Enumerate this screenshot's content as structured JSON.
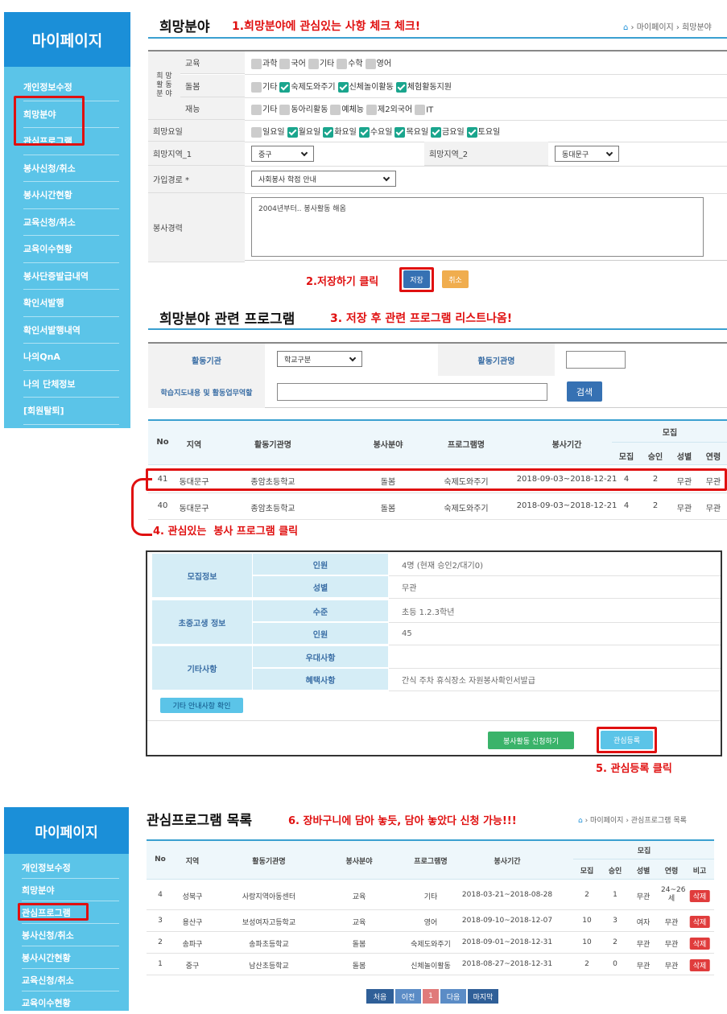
{
  "sidebar_top": {
    "title": "마이페이지",
    "items": [
      "개인정보수정",
      "희망분야",
      "관심프로그램",
      "봉사신청/취소",
      "봉사시간현황",
      "교육신청/취소",
      "교육이수현황",
      "봉사단증발급내역",
      "확인서발행",
      "확인서발행내역",
      "나의QnA",
      "나의 단체정보",
      "[회원탈퇴]"
    ]
  },
  "sidebar_bottom": {
    "title": "마이페이지",
    "items": [
      "개인정보수정",
      "희망분야",
      "관심프로그램",
      "봉사신청/취소",
      "봉사시간현황",
      "교육신청/취소",
      "교육이수현황"
    ]
  },
  "section1": {
    "title": "희망분야",
    "annotation": "1.희망분야에 관심있는 사항 체크 체크!",
    "breadcrumb": "› 마이페이지 › 희망분야"
  },
  "form": {
    "group_label": "희 망\n활 동\n분 야",
    "rows": [
      {
        "label": "교육",
        "options": [
          {
            "t": "과학",
            "on": false
          },
          {
            "t": "국어",
            "on": false
          },
          {
            "t": "기타",
            "on": false
          },
          {
            "t": "수학",
            "on": false
          },
          {
            "t": "영어",
            "on": false
          }
        ]
      },
      {
        "label": "돌봄",
        "options": [
          {
            "t": "기타",
            "on": false
          },
          {
            "t": "숙제도와주기",
            "on": true
          },
          {
            "t": "신체놀이활동",
            "on": true
          },
          {
            "t": "체험활동지원",
            "on": true
          }
        ]
      },
      {
        "label": "재능",
        "options": [
          {
            "t": "기타",
            "on": false
          },
          {
            "t": "동아리활동",
            "on": false
          },
          {
            "t": "예체능",
            "on": false
          },
          {
            "t": "제2외국어",
            "on": false
          },
          {
            "t": "IT",
            "on": false
          }
        ]
      }
    ],
    "day_label": "희망요일",
    "days": [
      {
        "t": "일요일",
        "on": false
      },
      {
        "t": "월요일",
        "on": true
      },
      {
        "t": "화요일",
        "on": true
      },
      {
        "t": "수요일",
        "on": true
      },
      {
        "t": "목요일",
        "on": true
      },
      {
        "t": "금요일",
        "on": true
      },
      {
        "t": "토요일",
        "on": true
      }
    ],
    "region1_label": "희망지역_1",
    "region1_value": "중구",
    "region2_label": "희망지역_2",
    "region2_value": "동대문구",
    "join_label": "가입경로 *",
    "join_value": "사회봉사 학점 안내",
    "career_label": "봉사경력",
    "career_value": "2004년부터.. 봉사활동 해옴"
  },
  "annotation2": "2.저장하기 클릭",
  "save_btn": "저장",
  "cancel_btn": "취소",
  "section2": {
    "title": "희망분야 관련 프로그램",
    "annotation": "3. 저장 후 관련 프로그램 리스트나옴!"
  },
  "search": {
    "org_label": "활동기관",
    "org_value": "학교구분",
    "orgname_label": "활동기관명",
    "content_label": "학습지도내용 및 활동업무역할",
    "btn": "검색"
  },
  "table1": {
    "headers": {
      "no": "No",
      "region": "지역",
      "org": "활동기관명",
      "field": "봉사분야",
      "program": "프로그램명",
      "period": "봉사기간",
      "recruit": "모집",
      "sub": [
        "모집",
        "승인",
        "성별",
        "연령"
      ]
    },
    "rows": [
      {
        "no": "41",
        "region": "동대문구",
        "org": "종암초등학교",
        "field": "돌봄",
        "program": "숙제도와주기",
        "period": "2018-09-03~2018-12-21",
        "recruit": "4",
        "approve": "2",
        "gender": "무관",
        "age": "무관"
      },
      {
        "no": "40",
        "region": "동대문구",
        "org": "종암초등학교",
        "field": "돌봄",
        "program": "숙제도와주기",
        "period": "2018-09-03~2018-12-21",
        "recruit": "4",
        "approve": "2",
        "gender": "무관",
        "age": "무관"
      }
    ]
  },
  "annotation4": "4. 관심있는  봉사 프로그램 클릭",
  "detail": {
    "groups": [
      {
        "label": "모집정보",
        "rows": [
          {
            "k": "인원",
            "v": "4명 (현재 승인2/대기0)"
          },
          {
            "k": "성별",
            "v": "무관"
          }
        ]
      },
      {
        "label": "초중고생 정보",
        "rows": [
          {
            "k": "수준",
            "v": "초등 1.2.3학년"
          },
          {
            "k": "인원",
            "v": "45"
          }
        ]
      },
      {
        "label": "기타사항",
        "rows": [
          {
            "k": "우대사항",
            "v": ""
          },
          {
            "k": "혜택사항",
            "v": "간식  주차  휴식장소  자원봉사확인서발급"
          }
        ]
      }
    ],
    "etc_btn": "기타 안내사항 확인",
    "apply_btn": "봉사활동 신청하기",
    "interest_btn": "관심등록"
  },
  "annotation5": "5. 관심등록 클릭",
  "section3": {
    "title": "관심프로그램 목록",
    "annotation": "6. 장바구니에 담아 놓듯, 담아 놓았다 신청 가능!!!",
    "breadcrumb": "› 마이페이지 › 관심프로그램 목록"
  },
  "table2": {
    "headers": {
      "no": "No",
      "region": "지역",
      "org": "활동기관명",
      "field": "봉사분야",
      "program": "프로그램명",
      "period": "봉사기간",
      "recruit": "모집",
      "sub": [
        "모집",
        "승인",
        "성별",
        "연령",
        "비고"
      ]
    },
    "rows": [
      {
        "no": "4",
        "region": "성북구",
        "org": "사랑지역아동센터",
        "field": "교육",
        "program": "기타",
        "period": "2018-03-21~2018-08-28",
        "recruit": "2",
        "approve": "1",
        "gender": "무관",
        "age": "24~26세",
        "del": "삭제"
      },
      {
        "no": "3",
        "region": "용산구",
        "org": "보성여자고등학교",
        "field": "교육",
        "program": "영어",
        "period": "2018-09-10~2018-12-07",
        "recruit": "10",
        "approve": "3",
        "gender": "여자",
        "age": "무관",
        "del": "삭제"
      },
      {
        "no": "2",
        "region": "송파구",
        "org": "송파초등학교",
        "field": "돌봄",
        "program": "숙제도와주기",
        "period": "2018-09-01~2018-12-31",
        "recruit": "10",
        "approve": "2",
        "gender": "무관",
        "age": "무관",
        "del": "삭제"
      },
      {
        "no": "1",
        "region": "중구",
        "org": "남산초등학교",
        "field": "돌봄",
        "program": "신체놀이활동",
        "period": "2018-08-27~2018-12-31",
        "recruit": "2",
        "approve": "0",
        "gender": "무관",
        "age": "무관",
        "del": "삭제"
      }
    ]
  },
  "pagination": [
    "처음",
    "이전",
    "1",
    "다음",
    "마지막"
  ],
  "colors": {
    "sidebar": "#5bc4e8",
    "sidebar_head": "#1b8fd8",
    "annotation": "#e01010",
    "checked": "#1aa58d"
  }
}
